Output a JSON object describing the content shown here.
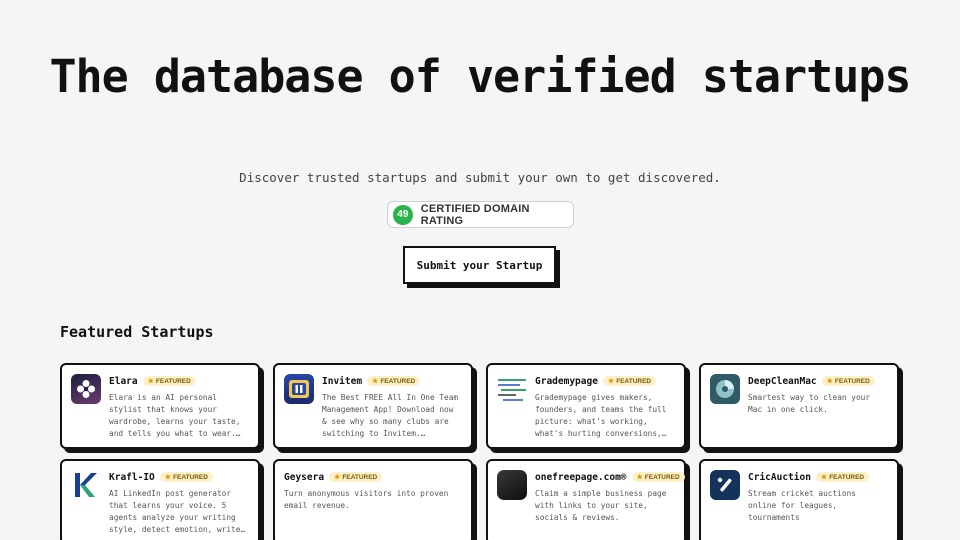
{
  "hero": {
    "title": "The database of verified startups",
    "subtitle": "Discover trusted startups and submit your own to get discovered.",
    "rating_value": "49",
    "rating_label": "CERTIFIED DOMAIN RATING",
    "submit_label": "Submit your Startup"
  },
  "featured": {
    "title": "Featured Startups",
    "badge_label": "FEATURED",
    "cards": [
      {
        "name": "Elara",
        "description": "Elara is an AI personal stylist that knows your wardrobe, learns your taste, and tells you what to wear. The…",
        "logo": "elara-logo-icon"
      },
      {
        "name": "Invitem",
        "description": "The Best FREE All In One Team Management App! Download now & see why so many clubs are switching to Invitem.…",
        "logo": "invitem-logo-icon"
      },
      {
        "name": "Grademypage",
        "description": "Grademypage gives makers, founders, and teams the full picture: what's working, what's hurting conversions, and…",
        "logo": "grademypage-logo-icon"
      },
      {
        "name": "DeepCleanMac",
        "description": "Smartest way to clean your Mac in one click.",
        "logo": "deepcleanmac-logo-icon"
      },
      {
        "name": "Krafl-IO",
        "description": "AI LinkedIn post generator that learns your voice. 5 agents analyze your writing style, detect emotion, write, format,…",
        "logo": "krafl-logo-icon"
      },
      {
        "name": "Geysera",
        "description": "Turn anonymous visitors into proven email revenue.",
        "logo": "geysera-logo-icon"
      },
      {
        "name": "onefreepage.com®",
        "description": "Claim a simple business page with links to your site, socials & reviews.",
        "logo": "onefreepage-logo-icon"
      },
      {
        "name": "CricAuction",
        "description": "Stream cricket auctions online for leagues, tournaments",
        "logo": "cricauction-logo-icon"
      }
    ]
  },
  "colors": {
    "background": "#f5f5f5",
    "rating_green": "#2bb24c",
    "featured_badge_bg": "#fdf0c8"
  }
}
